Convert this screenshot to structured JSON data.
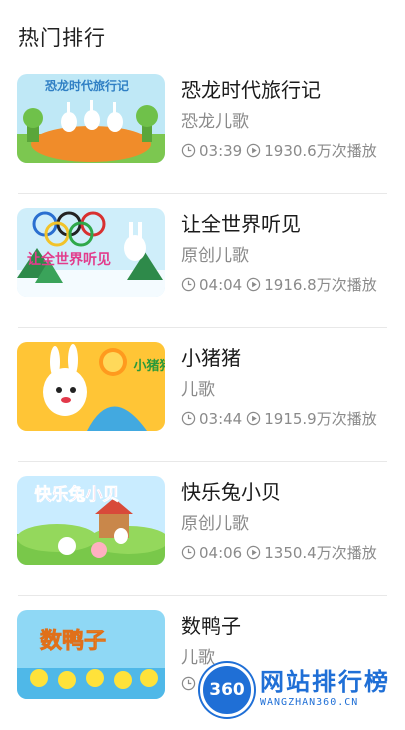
{
  "header": {
    "title": "热门排行"
  },
  "items": [
    {
      "title": "恐龙时代旅行记",
      "subtitle": "恐龙儿歌",
      "duration": "03:39",
      "plays": "1930.6万次播放"
    },
    {
      "title": "让全世界听见",
      "subtitle": "原创儿歌",
      "duration": "04:04",
      "plays": "1916.8万次播放"
    },
    {
      "title": "小猪猪",
      "subtitle": "儿歌",
      "duration": "03:44",
      "plays": "1915.9万次播放"
    },
    {
      "title": "快乐兔小贝",
      "subtitle": "原创儿歌",
      "duration": "04:06",
      "plays": "1350.4万次播放"
    },
    {
      "title": "数鸭子",
      "subtitle": "儿歌",
      "duration": "",
      "plays": ""
    }
  ],
  "thumb_text": {
    "item0": "恐龙时代旅行记",
    "item1": "让全世界听见",
    "item2": "小猪猪",
    "item3": "快乐兔小贝",
    "item4": "数鸭子"
  },
  "watermark": {
    "badge": "360",
    "text": "网站排行榜",
    "sub": "WANGZHAN360.CN"
  },
  "icons": {
    "duration": "clock-icon",
    "plays": "play-circle-icon"
  },
  "colors": {
    "title": "#1b1b1b",
    "secondary": "#8a8a8a",
    "divider": "#e8e8e8",
    "watermark": "#1f6fd6"
  }
}
